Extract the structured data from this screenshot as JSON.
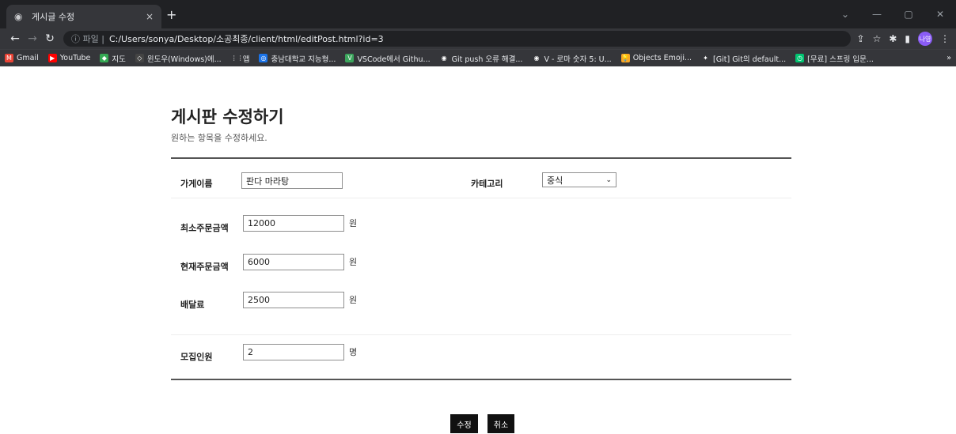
{
  "browser": {
    "tab_title": "게시글 수정",
    "tab_close": "×",
    "new_tab": "+",
    "url_protocol": "ⓘ 파일 |",
    "url": "C:/Users/sonya/Desktop/소공최종/client/html/editPost.html?id=3",
    "profile_label": "나영",
    "bookmarks": [
      {
        "label": "Gmail",
        "color": "#ea4335",
        "glyph": "M"
      },
      {
        "label": "YouTube",
        "color": "#ff0000",
        "glyph": "▶"
      },
      {
        "label": "지도",
        "color": "#34a853",
        "glyph": "◆"
      },
      {
        "label": "윈도우(Windows)에...",
        "color": "#444444",
        "glyph": "◇"
      },
      {
        "label": "앱",
        "color": "#35363a",
        "glyph": "⋮⋮"
      },
      {
        "label": "충남대학교 지능형...",
        "color": "#1a73e8",
        "glyph": "◎"
      },
      {
        "label": "VSCode에서 Githu...",
        "color": "#3ba55c",
        "glyph": "V"
      },
      {
        "label": "Git push 오류 해결...",
        "color": "#35363a",
        "glyph": "◉"
      },
      {
        "label": "V - 로마 숫자 5: U...",
        "color": "#35363a",
        "glyph": "◉"
      },
      {
        "label": "Objects Emoji...",
        "color": "#f9a825",
        "glyph": "💡"
      },
      {
        "label": "[Git] Git의 default...",
        "color": "#35363a",
        "glyph": "✦"
      },
      {
        "label": "[무료] 스프링 입문...",
        "color": "#00c471",
        "glyph": "◷"
      }
    ],
    "bookmarks_more": "»"
  },
  "page": {
    "title": "게시판 수정하기",
    "subtitle": "원하는 항목을 수정하세요."
  },
  "form": {
    "store_name": {
      "label": "가게이름",
      "value": "판다 마라탕"
    },
    "category": {
      "label": "카테고리",
      "value": "중식"
    },
    "min_order": {
      "label": "최소주문금액",
      "value": "12000",
      "unit": "원"
    },
    "current_order": {
      "label": "현재주문금액",
      "value": "6000",
      "unit": "원"
    },
    "delivery_fee": {
      "label": "배달료",
      "value": "2500",
      "unit": "원"
    },
    "recruit": {
      "label": "모집인원",
      "value": "2",
      "unit": "명"
    }
  },
  "actions": {
    "submit": "수정",
    "cancel": "취소"
  },
  "colors": {
    "chrome_dark": "#202124",
    "chrome_toolbar": "#35363a",
    "button": "#111111"
  }
}
